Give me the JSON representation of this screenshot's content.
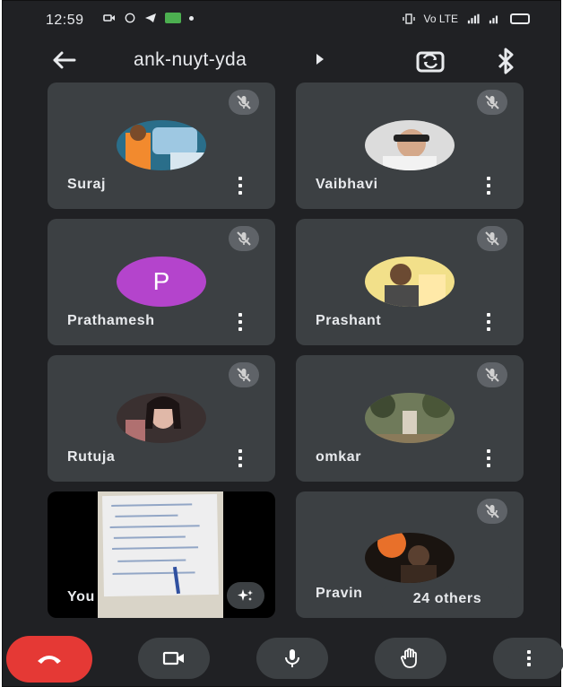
{
  "status_bar": {
    "time": "12:59",
    "right_text": "Vo LTE"
  },
  "top_bar": {
    "meeting_code": "ank-nuyt-yda"
  },
  "participants": [
    {
      "name": "Suraj",
      "muted": true,
      "avatar": "photo"
    },
    {
      "name": "Vaibhavi",
      "muted": true,
      "avatar": "photo"
    },
    {
      "name": "Prathamesh",
      "muted": true,
      "avatar": "letter",
      "letter": "P",
      "color": "#b444cc"
    },
    {
      "name": "Prashant",
      "muted": true,
      "avatar": "photo"
    },
    {
      "name": "Rutuja",
      "muted": true,
      "avatar": "photo"
    },
    {
      "name": "omkar",
      "muted": true,
      "avatar": "photo"
    },
    {
      "name": "You",
      "self_view": true
    },
    {
      "name": "Pravin",
      "muted": true,
      "avatar": "photo"
    }
  ],
  "others_label": "24 others",
  "controls": {
    "end_call": "end-call-icon",
    "camera": "video-camera-icon",
    "mic": "microphone-icon",
    "raise_hand": "raise-hand-icon",
    "more": "more-vert-icon"
  },
  "colors": {
    "background": "#202124",
    "tile": "#3c4043",
    "end_call": "#e53935",
    "accent_avatar": "#b444cc"
  }
}
